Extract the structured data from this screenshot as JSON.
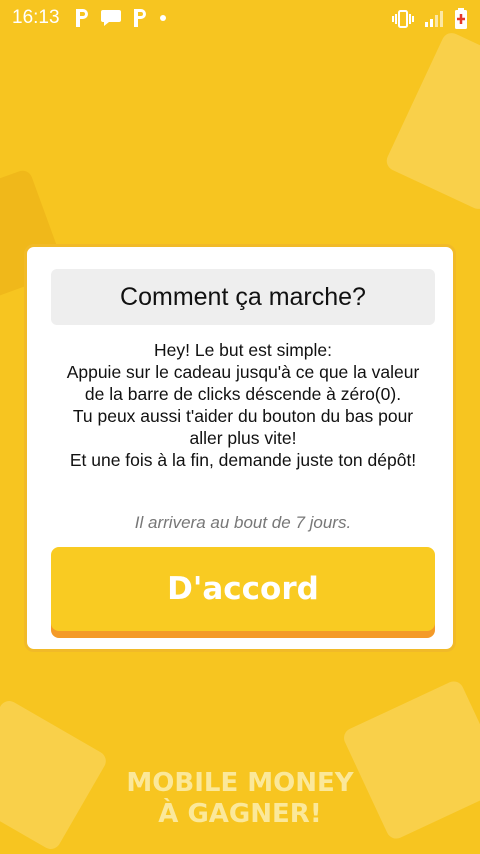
{
  "status_bar": {
    "time": "16:13",
    "left_icons": [
      "parking-icon",
      "chat-bubble-icon",
      "parking-icon",
      "dot-icon"
    ],
    "right_icons": [
      "vibrate-icon",
      "signal-icon",
      "battery-icon"
    ]
  },
  "dialog": {
    "title": "Comment ça marche?",
    "body_lines": [
      "Hey! Le but est simple:",
      "Appuie sur le cadeau jusqu'à ce que la valeur de la barre de clicks déscende à zéro(0).",
      "Tu peux aussi t'aider du bouton du bas pour aller plus vite!",
      "Et une fois à la fin, demande juste ton dépôt!"
    ],
    "note": "Il arrivera au bout de 7 jours.",
    "ok_label": "D'accord"
  },
  "brand": {
    "line1": "MOBILE MONEY",
    "line2": "À GAGNER!"
  },
  "colors": {
    "background": "#F7C520",
    "button": "#F9CB22",
    "button_shadow": "#F49A28",
    "brand_text": "#FBE89A"
  }
}
